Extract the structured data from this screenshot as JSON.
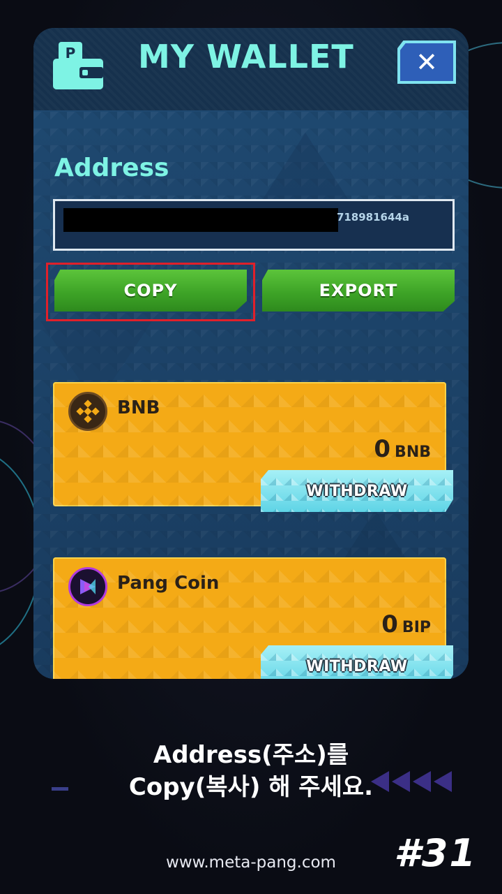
{
  "header": {
    "title": "MY WALLET",
    "close_label": "✕"
  },
  "address": {
    "label": "Address",
    "value_visible": "718981644a"
  },
  "buttons": {
    "copy": "COPY",
    "export": "EXPORT"
  },
  "coins": [
    {
      "name": "BNB",
      "amount": "0",
      "unit": "BNB",
      "withdraw_label": "WITHDRAW",
      "icon": "bnb-logo-icon"
    },
    {
      "name": "Pang Coin",
      "amount": "0",
      "unit": "BIP",
      "withdraw_label": "WITHDRAW",
      "icon": "pang-coin-logo-icon"
    }
  ],
  "caption": {
    "line1": "Address(주소)를",
    "line2": "Copy(복사) 해 주세요."
  },
  "footer": {
    "website": "www.meta-pang.com",
    "page_number": "#31"
  },
  "colors": {
    "title_teal": "#7ef3e4",
    "green_button": "#3ea427",
    "coin_card_orange": "#f4aa16",
    "withdraw_cyan": "#5fd4e6",
    "highlight_red": "#e0202a",
    "panel_blue": "#1b3e62"
  }
}
